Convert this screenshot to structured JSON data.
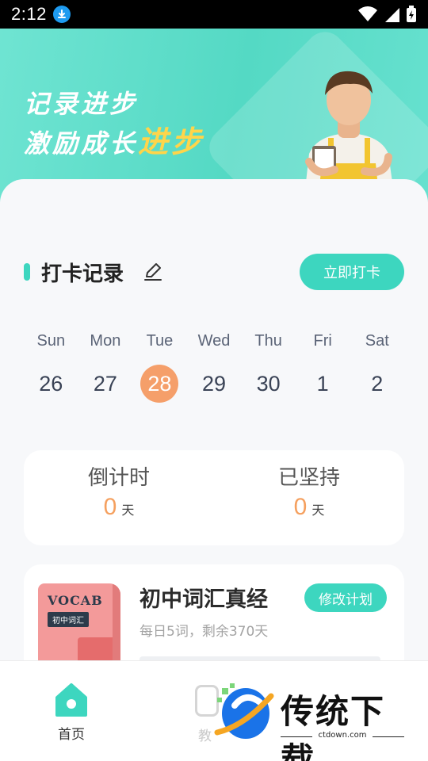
{
  "status_bar": {
    "time": "2:12"
  },
  "banner": {
    "line1": "记录进步",
    "line2_main": "激励成长",
    "line2_accent": "进步"
  },
  "checkin": {
    "title": "打卡记录",
    "action_label": "立即打卡"
  },
  "week": {
    "days": [
      {
        "name": "Sun",
        "date": "26"
      },
      {
        "name": "Mon",
        "date": "27"
      },
      {
        "name": "Tue",
        "date": "28"
      },
      {
        "name": "Wed",
        "date": "29"
      },
      {
        "name": "Thu",
        "date": "30"
      },
      {
        "name": "Fri",
        "date": "1"
      },
      {
        "name": "Sat",
        "date": "2"
      }
    ],
    "selected": "Tue"
  },
  "stats": {
    "countdown": {
      "label": "倒计时",
      "value": "0",
      "unit": "天"
    },
    "persisted": {
      "label": "已坚持",
      "value": "0",
      "unit": "天"
    }
  },
  "plan": {
    "book_title": "VOCAB",
    "book_tag": "初中词汇",
    "title": "初中词汇真经",
    "subtitle": "每日5词，剩余370天",
    "edit_label": "修改计划"
  },
  "nav": {
    "home_label": "首页",
    "second_label": "教"
  },
  "watermark": {
    "text": "传统下载",
    "url": "ctdown.com"
  },
  "colors": {
    "accent": "#3dd6bf",
    "highlight": "#f59f6a",
    "value": "#f5a05f"
  }
}
